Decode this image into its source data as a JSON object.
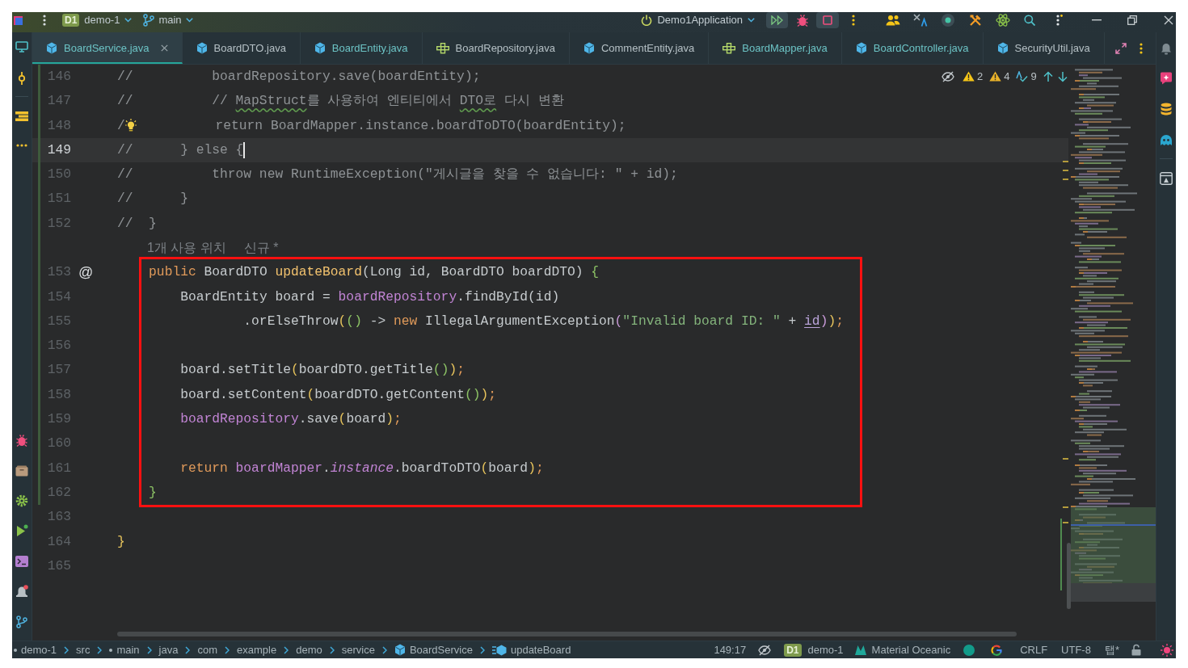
{
  "title_bar": {
    "project_badge": "D1",
    "project": "demo-1",
    "branch": "main",
    "run_config": "Demo1Application"
  },
  "tabs": [
    {
      "label": "BoardService.java",
      "kind": "class",
      "selected": true,
      "modified": true
    },
    {
      "label": "BoardDTO.java",
      "kind": "class",
      "selected": false,
      "modified": false
    },
    {
      "label": "BoardEntity.java",
      "kind": "class",
      "selected": false,
      "modified": true
    },
    {
      "label": "BoardRepository.java",
      "kind": "interface",
      "selected": false,
      "modified": false
    },
    {
      "label": "CommentEntity.java",
      "kind": "class",
      "selected": false,
      "modified": false
    },
    {
      "label": "BoardMapper.java",
      "kind": "interface",
      "selected": false,
      "modified": true
    },
    {
      "label": "BoardController.java",
      "kind": "class",
      "selected": false,
      "modified": true
    },
    {
      "label": "SecurityUtil.java",
      "kind": "class",
      "selected": false,
      "modified": false
    }
  ],
  "editor": {
    "inspections": [
      {
        "kind": "warning",
        "count": "2"
      },
      {
        "kind": "weak_warning",
        "count": "4"
      },
      {
        "kind": "typo",
        "count": "9"
      }
    ],
    "lines": [
      {
        "kind": "code",
        "number": "146",
        "changed": true,
        "current": false,
        "tokens": [
          {
            "kind": "comment",
            "text": "//          boardRepository.save(boardEntity);"
          }
        ]
      },
      {
        "kind": "code",
        "number": "147",
        "changed": true,
        "current": false,
        "tokens": [
          {
            "kind": "comment",
            "text": "//          // "
          },
          {
            "kind": "typo",
            "text": "MapStruct"
          },
          {
            "kind": "comment",
            "text": "를 사용하여 엔티티에서 "
          },
          {
            "kind": "typo",
            "text": "DTO로"
          },
          {
            "kind": "comment",
            "text": " 다시 변환"
          }
        ]
      },
      {
        "kind": "code",
        "number": "148",
        "changed": true,
        "current": false,
        "tokens": [
          {
            "kind": "comment",
            "text": "/"
          },
          {
            "kind": "bulb"
          },
          {
            "kind": "comment",
            "text": "          return BoardMapper.instance.boardToDTO(boardEntity);"
          }
        ]
      },
      {
        "kind": "code",
        "number": "149",
        "changed": true,
        "current": true,
        "tokens": [
          {
            "kind": "comment",
            "text": "//      } else {"
          }
        ]
      },
      {
        "kind": "code",
        "number": "150",
        "changed": true,
        "current": false,
        "tokens": [
          {
            "kind": "comment",
            "text": "//          throw new RuntimeException(\"게시글을 찾을 수 없습니다: \" + id);"
          }
        ]
      },
      {
        "kind": "code",
        "number": "151",
        "changed": true,
        "current": false,
        "tokens": [
          {
            "kind": "comment",
            "text": "//      }"
          }
        ]
      },
      {
        "kind": "code",
        "number": "152",
        "changed": true,
        "current": false,
        "tokens": [
          {
            "kind": "comment",
            "text": "//  }"
          }
        ]
      },
      {
        "kind": "inlay",
        "changed": true,
        "hints": [
          "1개 사용 위치",
          "신규 *"
        ]
      },
      {
        "kind": "framed_block",
        "lines": [
          {
            "kind": "code",
            "number": "153",
            "changed": true,
            "current": false,
            "gutter_mark": "@",
            "tokens": [
              {
                "kind": "keyword",
                "text": "    public"
              },
              {
                "kind": "plain",
                "text": " BoardDTO "
              },
              {
                "kind": "method",
                "text": "updateBoard"
              },
              {
                "kind": "plain",
                "text": "(Long id, BoardDTO boardDTO) "
              },
              {
                "kind": "brace2",
                "text": "{"
              }
            ]
          },
          {
            "kind": "code",
            "number": "154",
            "changed": true,
            "current": false,
            "tokens": [
              {
                "kind": "plain",
                "text": "        BoardEntity board = "
              },
              {
                "kind": "field",
                "text": "boardRepository"
              },
              {
                "kind": "plain",
                "text": ".findById(id)"
              }
            ]
          },
          {
            "kind": "code",
            "number": "155",
            "changed": true,
            "current": false,
            "tokens": [
              {
                "kind": "plain",
                "text": "                .orElseThrow"
              },
              {
                "kind": "brace1",
                "text": "("
              },
              {
                "kind": "brace2",
                "text": "()"
              },
              {
                "kind": "plain",
                "text": " -> "
              },
              {
                "kind": "keyword",
                "text": "new"
              },
              {
                "kind": "plain",
                "text": " IllegalArgumentException"
              },
              {
                "kind": "brace3",
                "text": "("
              },
              {
                "kind": "string",
                "text": "\"Invalid board ID: \""
              },
              {
                "kind": "plain",
                "text": " + "
              },
              {
                "kind": "param_ref",
                "text": "id"
              },
              {
                "kind": "brace3",
                "text": ")"
              },
              {
                "kind": "brace1",
                "text": ")"
              },
              {
                "kind": "punct",
                "text": ";"
              }
            ]
          },
          {
            "kind": "code",
            "number": "156",
            "changed": true,
            "current": false
          },
          {
            "kind": "code",
            "number": "157",
            "changed": true,
            "current": false,
            "tokens": [
              {
                "kind": "plain",
                "text": "        board.setTitle"
              },
              {
                "kind": "brace1",
                "text": "("
              },
              {
                "kind": "plain",
                "text": "boardDTO.getTitle"
              },
              {
                "kind": "brace2",
                "text": "()"
              },
              {
                "kind": "brace1",
                "text": ")"
              },
              {
                "kind": "punct",
                "text": ";"
              }
            ]
          },
          {
            "kind": "code",
            "number": "158",
            "changed": true,
            "current": false,
            "tokens": [
              {
                "kind": "plain",
                "text": "        board.setContent"
              },
              {
                "kind": "brace1",
                "text": "("
              },
              {
                "kind": "plain",
                "text": "boardDTO.getContent"
              },
              {
                "kind": "brace2",
                "text": "()"
              },
              {
                "kind": "brace1",
                "text": ")"
              },
              {
                "kind": "punct",
                "text": ";"
              }
            ]
          },
          {
            "kind": "code",
            "number": "159",
            "changed": true,
            "current": false,
            "tokens": [
              {
                "kind": "field",
                "text": "        boardRepository"
              },
              {
                "kind": "plain",
                "text": ".save"
              },
              {
                "kind": "brace1",
                "text": "("
              },
              {
                "kind": "plain",
                "text": "board"
              },
              {
                "kind": "brace1",
                "text": ")"
              },
              {
                "kind": "punct",
                "text": ";"
              }
            ]
          },
          {
            "kind": "code",
            "number": "160",
            "changed": true,
            "current": false
          },
          {
            "kind": "code",
            "number": "161",
            "changed": true,
            "current": false,
            "tokens": [
              {
                "kind": "keyword",
                "text": "        return"
              },
              {
                "kind": "field",
                "text": " boardMapper"
              },
              {
                "kind": "plain",
                "text": "."
              },
              {
                "kind": "field_italic",
                "text": "instance"
              },
              {
                "kind": "plain",
                "text": ".boardToDTO"
              },
              {
                "kind": "brace1",
                "text": "("
              },
              {
                "kind": "plain",
                "text": "board"
              },
              {
                "kind": "brace1",
                "text": ")"
              },
              {
                "kind": "punct",
                "text": ";"
              }
            ]
          },
          {
            "kind": "code",
            "number": "162",
            "changed": true,
            "current": false,
            "tokens": [
              {
                "kind": "brace2",
                "text": "    }"
              }
            ]
          }
        ]
      },
      {
        "kind": "code",
        "number": "163",
        "changed": false,
        "current": false
      },
      {
        "kind": "code",
        "number": "164",
        "changed": false,
        "current": false,
        "tokens": [
          {
            "kind": "brace1",
            "text": "}"
          }
        ]
      },
      {
        "kind": "code",
        "number": "165",
        "changed": false,
        "current": false
      }
    ]
  },
  "status_bar": {
    "breadcrumbs": [
      {
        "label": "demo-1",
        "kind": "module"
      },
      {
        "label": "src",
        "kind": "folder"
      },
      {
        "label": "main",
        "kind": "source_root"
      },
      {
        "label": "java",
        "kind": "folder"
      },
      {
        "label": "com",
        "kind": "folder"
      },
      {
        "label": "example",
        "kind": "folder"
      },
      {
        "label": "demo",
        "kind": "folder"
      },
      {
        "label": "service",
        "kind": "folder"
      },
      {
        "label": "BoardService",
        "kind": "class"
      },
      {
        "label": "updateBoard",
        "kind": "method"
      }
    ],
    "caret_position": "149:17",
    "project_badge": "D1",
    "project": "demo-1",
    "theme": "Material Oceanic",
    "line_separator": "CRLF",
    "encoding": "UTF-8",
    "indent": "탭*"
  }
}
